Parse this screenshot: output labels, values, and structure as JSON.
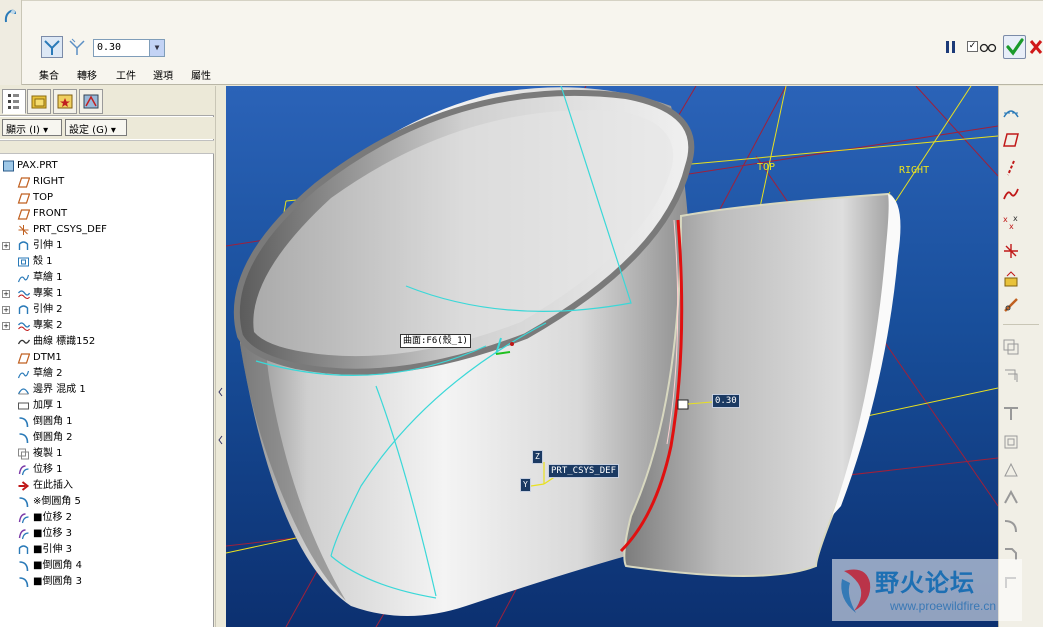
{
  "dashboard": {
    "depth_value": "0.30",
    "tabs": [
      "集合",
      "轉移",
      "工件",
      "選項",
      "屬性"
    ]
  },
  "left_panel": {
    "show_button": "顯示 (I)",
    "settings_button": "設定 (G)"
  },
  "model_tree": [
    {
      "label": "PAX.PRT",
      "icon": "part-icon",
      "expand": false,
      "root": true
    },
    {
      "label": "RIGHT",
      "icon": "datum-plane-icon",
      "expand": false
    },
    {
      "label": "TOP",
      "icon": "datum-plane-icon",
      "expand": false
    },
    {
      "label": "FRONT",
      "icon": "datum-plane-icon",
      "expand": false
    },
    {
      "label": "PRT_CSYS_DEF",
      "icon": "csys-icon",
      "expand": false
    },
    {
      "label": "引伸 1",
      "icon": "extrude-icon",
      "expand": true
    },
    {
      "label": "殼 1",
      "icon": "shell-icon",
      "expand": false
    },
    {
      "label": "草繪 1",
      "icon": "sketch-icon",
      "expand": false
    },
    {
      "label": "專案 1",
      "icon": "project-curve-icon",
      "expand": true
    },
    {
      "label": "引伸 2",
      "icon": "extrude-icon",
      "expand": true
    },
    {
      "label": "專案 2",
      "icon": "project-curve-icon",
      "expand": true
    },
    {
      "label": "曲線 標識152",
      "icon": "curve-icon",
      "expand": false
    },
    {
      "label": "DTM1",
      "icon": "datum-plane-icon",
      "expand": false
    },
    {
      "label": "草繪 2",
      "icon": "sketch-icon",
      "expand": false
    },
    {
      "label": "邊界 混成 1",
      "icon": "boundary-blend-icon",
      "expand": false
    },
    {
      "label": "加厚 1",
      "icon": "thicken-icon",
      "expand": false
    },
    {
      "label": "倒圓角 1",
      "icon": "round-icon",
      "expand": false
    },
    {
      "label": "倒圓角 2",
      "icon": "round-icon",
      "expand": false
    },
    {
      "label": "複製 1",
      "icon": "copy-icon",
      "expand": false
    },
    {
      "label": "位移 1",
      "icon": "offset-icon",
      "expand": false
    },
    {
      "label": "在此插入",
      "icon": "insert-here-arrow-icon",
      "expand": false
    },
    {
      "label": "※倒圓角 5",
      "icon": "round-icon",
      "expand": false
    },
    {
      "label": "■位移 2",
      "icon": "offset-icon",
      "expand": false
    },
    {
      "label": "■位移 3",
      "icon": "offset-icon",
      "expand": false
    },
    {
      "label": "■引伸 3",
      "icon": "extrude-icon",
      "expand": false
    },
    {
      "label": "■倒圓角 4",
      "icon": "round-icon",
      "expand": false
    },
    {
      "label": "■倒圓角 3",
      "icon": "round-icon",
      "expand": false
    }
  ],
  "viewport": {
    "surface_tag": "曲面:F6(殼_1)",
    "depth_tag": "0.30",
    "csys_tag": "PRT_CSYS_DEF",
    "axis_z": "Z",
    "axis_y": "Y",
    "plane_top": "TOP",
    "plane_right": "RIGHT"
  },
  "watermark": {
    "title": "野火论坛",
    "url": "www.proewildfire.cn"
  },
  "colors": {
    "viewport_top": "#2b63b8",
    "viewport_bottom": "#0c3070",
    "datum_plane": "#e8e020",
    "datum_line": "#a0203a",
    "curve": "#3ad8d8",
    "highlight": "#e01010"
  }
}
